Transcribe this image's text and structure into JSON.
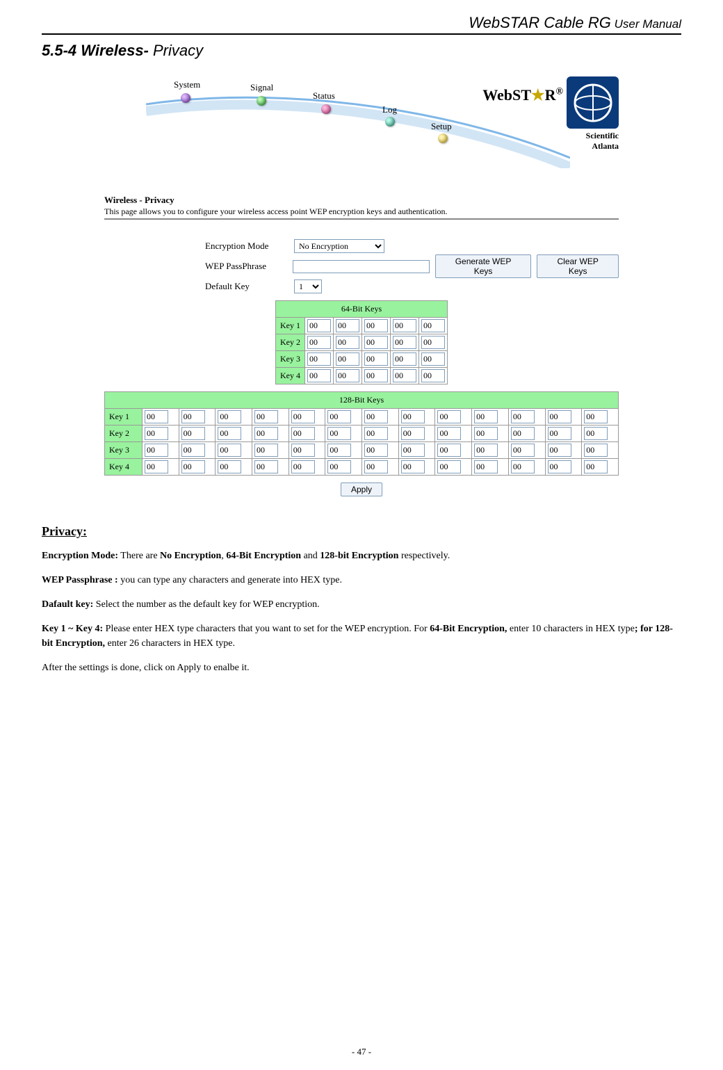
{
  "header": {
    "line_bold": "WebSTAR Cable RG",
    "line_small": " User Manual"
  },
  "section": {
    "num": "5.5-4 Wireless-",
    "title": " Privacy"
  },
  "banner": {
    "nav": [
      "System",
      "Signal",
      "Status",
      "Log",
      "Setup"
    ],
    "brand": "WebST",
    "brand_reg": "®",
    "brand_tail": "R",
    "subbrand1": "Scientific",
    "subbrand2": "Atlanta"
  },
  "form": {
    "page_heading": "Wireless - Privacy",
    "page_desc": "This page allows you to configure your wireless access point WEP encryption keys and authentication.",
    "labels": {
      "encmode": "Encryption Mode",
      "passphrase": "WEP PassPhrase",
      "defaultkey": "Default Key"
    },
    "encmode_value": "No Encryption",
    "defaultkey_value": "1",
    "btn_generate": "Generate WEP Keys",
    "btn_clear": "Clear WEP Keys",
    "table64_title": "64-Bit Keys",
    "table128_title": "128-Bit Keys",
    "rowlabels": [
      "Key 1",
      "Key 2",
      "Key 3",
      "Key 4"
    ],
    "cell_default": "00",
    "apply": "Apply"
  },
  "desc": {
    "h": "Privacy:",
    "p1a": "Encryption Mode:",
    "p1b": " There are ",
    "p1c": "No Encryption",
    "p1d": ", ",
    "p1e": "64-Bit Encryption",
    "p1f": " and ",
    "p1g": "128-bit Encryption",
    "p1h": " respectively.",
    "p2a": "WEP Passphrase :",
    "p2b": " you can type any characters and generate into HEX type.",
    "p3a": "Dafault key:",
    "p3b": " Select the number as the default key for WEP encryption.",
    "p4a": "Key 1 ~ Key 4:",
    "p4b": "   Please enter HEX type characters that you want to set for the WEP encryption. For ",
    "p4c": "64-Bit Encryption,",
    "p4d": " enter 10 characters in HEX type",
    "p4e": "; for 128-bit Encryption,",
    "p4f": " enter 26 characters in HEX type.",
    "p5": "After the settings is done, click on Apply to enalbe it."
  },
  "page_number": "- 47 -"
}
